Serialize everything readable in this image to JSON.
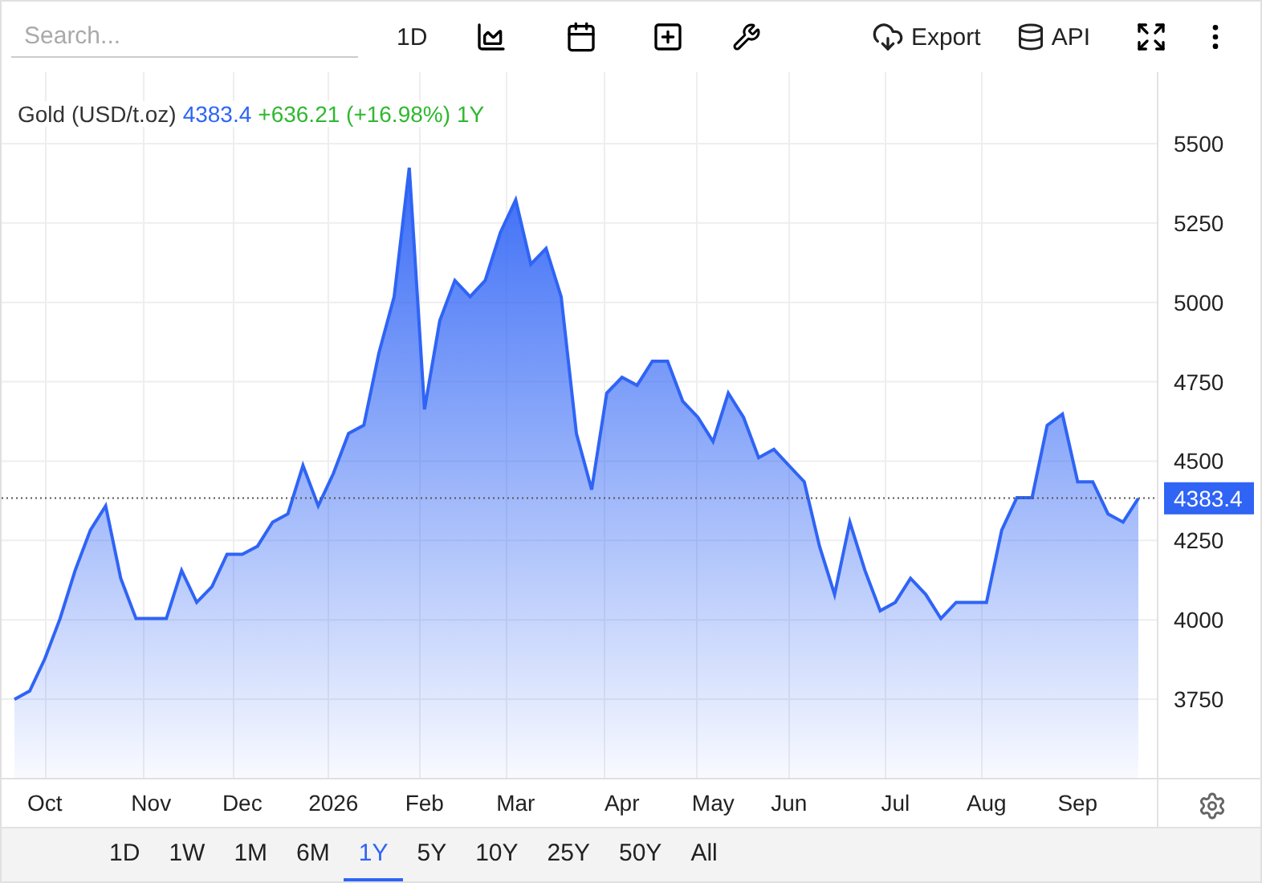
{
  "toolbar": {
    "search_placeholder": "Search...",
    "interval": "1D",
    "export_label": "Export",
    "api_label": "API"
  },
  "legend": {
    "price": "4383.4",
    "change": "+636.21 (+16.98%)",
    "period": "1Y"
  },
  "price_tag": "4383.4",
  "chart": {
    "chart_data": {
      "type": "area",
      "ylim": [
        3500,
        5725
      ],
      "grid": true,
      "ref_lines": [
        {
          "axis": "y",
          "value": 4383.4
        }
      ],
      "yticks": [
        3750,
        4000,
        4250,
        4500,
        4750,
        5000,
        5250,
        5500
      ],
      "categories": [
        null,
        null,
        "Oct",
        null,
        null,
        null,
        null,
        null,
        null,
        "Nov",
        null,
        null,
        null,
        null,
        null,
        "Dec",
        null,
        null,
        null,
        null,
        null,
        "2026",
        null,
        null,
        null,
        null,
        null,
        "Feb",
        null,
        null,
        null,
        null,
        null,
        "Mar",
        null,
        null,
        null,
        null,
        null,
        null,
        "Apr",
        null,
        null,
        null,
        null,
        null,
        "May",
        null,
        null,
        null,
        null,
        "Jun",
        null,
        null,
        null,
        null,
        null,
        null,
        "Jul",
        null,
        null,
        null,
        null,
        null,
        "Aug",
        null,
        null,
        null,
        null,
        null,
        "Sep",
        null,
        null,
        null,
        null
      ],
      "series": [
        {
          "name": "Gold (USD/t.oz)",
          "color": "#2f64f5",
          "values": [
            3750,
            3776,
            3877,
            4004,
            4156,
            4283,
            4359,
            4131,
            4004,
            4004,
            4004,
            4156,
            4055,
            4105,
            4207,
            4207,
            4232,
            4308,
            4334,
            4486,
            4359,
            4461,
            4587,
            4613,
            4841,
            5018,
            5424,
            4663,
            4942,
            5069,
            5018,
            5069,
            5221,
            5323,
            5120,
            5170,
            5018,
            4587,
            4410,
            4714,
            4764,
            4739,
            4815,
            4815,
            4689,
            4638,
            4562,
            4714,
            4638,
            4511,
            4537,
            4486,
            4435,
            4232,
            4080,
            4308,
            4156,
            4029,
            4055,
            4131,
            4080,
            4004,
            4055,
            4055,
            4055,
            4283,
            4385,
            4385,
            4613,
            4648,
            4435,
            4435,
            4334,
            4308,
            4383
          ]
        }
      ]
    }
  },
  "ranges": [
    {
      "label": "1D",
      "selected": false
    },
    {
      "label": "1W",
      "selected": false
    },
    {
      "label": "1M",
      "selected": false
    },
    {
      "label": "6M",
      "selected": false
    },
    {
      "label": "1Y",
      "selected": true
    },
    {
      "label": "5Y",
      "selected": false
    },
    {
      "label": "10Y",
      "selected": false
    },
    {
      "label": "25Y",
      "selected": false
    },
    {
      "label": "50Y",
      "selected": false
    },
    {
      "label": "All",
      "selected": false
    }
  ]
}
